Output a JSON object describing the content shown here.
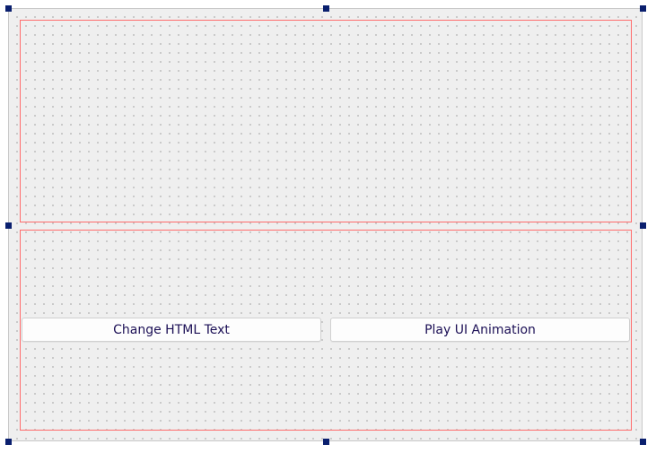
{
  "form": {
    "buttons": {
      "change_html": "Change HTML Text",
      "play_animation": "Play UI Animation"
    }
  },
  "colors": {
    "layout_border": "#ff6b6b",
    "handle": "#0a1f6e",
    "canvas_bg": "#efefef",
    "button_text": "#1b0f55"
  }
}
